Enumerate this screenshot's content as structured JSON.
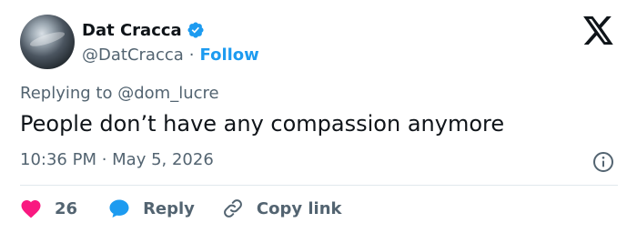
{
  "author": {
    "name": "Dat Cracca",
    "handle": "@DatCracca",
    "separator": "·",
    "follow_label": "Follow",
    "verified_badge_icon": "verified-badge-icon",
    "verified_color": "#1d9bf0"
  },
  "platform_icon": "x-logo-icon",
  "reply_context": {
    "prefix": "Replying to",
    "mention": "@dom_lucre"
  },
  "tweet": {
    "text": "People don’t have any compassion anymore",
    "timestamp": "10:36 PM · May 5, 2026"
  },
  "actions": {
    "like_icon": "heart-icon",
    "like_count": "26",
    "like_color": "#f91880",
    "reply_icon": "speech-bubble-icon",
    "reply_label": "Reply",
    "reply_color": "#1d9bf0",
    "copy_icon": "link-icon",
    "copy_label": "Copy link"
  },
  "info_icon": "info-icon",
  "colors": {
    "text_primary": "#0f1419",
    "text_secondary": "#536471",
    "accent": "#1d9bf0",
    "divider": "#e1e8ed"
  }
}
